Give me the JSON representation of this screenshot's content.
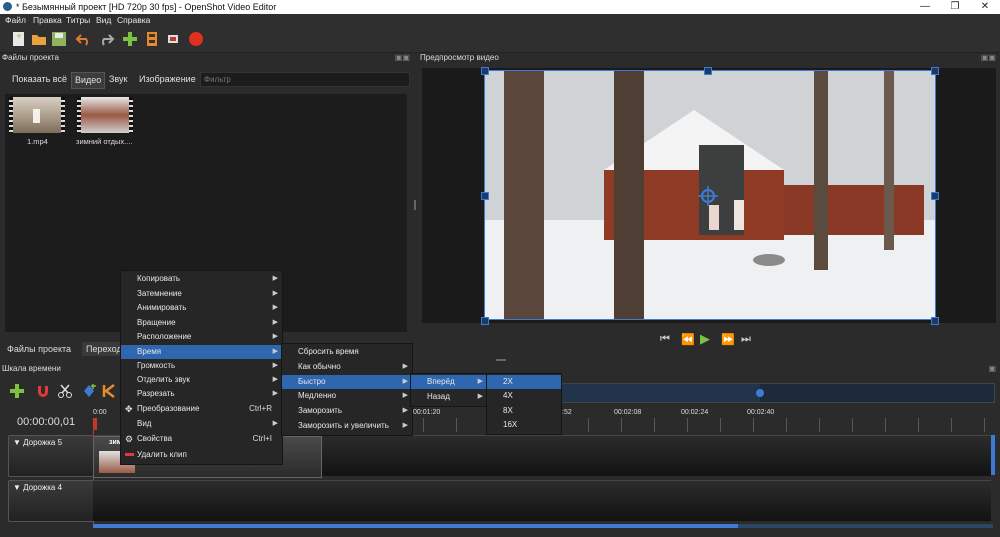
{
  "window": {
    "title": "* Безымянный проект [HD 720p 30 fps] - OpenShot Video Editor"
  },
  "menu": [
    "Файл",
    "Правка",
    "Титры",
    "Вид",
    "Справка"
  ],
  "toolbar": {
    "buttons": [
      "new-project-icon",
      "open-project-icon",
      "save-project-icon",
      "undo-icon",
      "redo-icon",
      "import-files-icon",
      "profile-icon",
      "fullscreen-icon",
      "export-video-icon"
    ]
  },
  "project_files": {
    "header": "Файлы проекта",
    "filters": [
      "Показать всё",
      "Видео",
      "Звук",
      "Изображение"
    ],
    "filter_placeholder": "Фильтр",
    "files": [
      "1.mp4",
      "зимний отдых...."
    ]
  },
  "preview": {
    "header": "Предпросмотр видео"
  },
  "bottom_tabs": [
    "Файлы проекта",
    "Переход"
  ],
  "timeline": {
    "header": "Шкала времени",
    "timecode": "00:00:00,01",
    "ruler_labels": [
      "0:00",
      "00:01:20",
      ":52",
      "00:02:08",
      "00:02:24",
      "00:02:40"
    ],
    "tracks": [
      "Дорожка 5",
      "Дорожка 4"
    ],
    "clip_label": "зим"
  },
  "context_menu": {
    "items": [
      {
        "label": "Копировать",
        "submenu": true
      },
      {
        "label": "Затемнение",
        "submenu": true
      },
      {
        "label": "Анимировать",
        "submenu": true
      },
      {
        "label": "Вращение",
        "submenu": true
      },
      {
        "label": "Расположение",
        "submenu": true
      },
      {
        "label": "Время",
        "submenu": true,
        "selected": true
      },
      {
        "label": "Громкость",
        "submenu": true
      },
      {
        "label": "Отделить звук",
        "submenu": true
      },
      {
        "label": "Разрезать",
        "submenu": true
      },
      {
        "label": "Преобразование",
        "shortcut": "Ctrl+R"
      },
      {
        "label": "Вид",
        "submenu": true
      },
      {
        "label": "Свойства",
        "shortcut": "Ctrl+I"
      },
      {
        "label": "Удалить клип"
      }
    ]
  },
  "time_submenu": {
    "items": [
      "Сбросить время",
      "Как обычно",
      "Быстро",
      "Медленно",
      "Заморозить",
      "Заморозить и увеличить"
    ],
    "selected": "Быстро"
  },
  "fast_submenu": {
    "items": [
      "Вперёд",
      "Назад"
    ],
    "selected": "Вперёд"
  },
  "forward_submenu": {
    "items": [
      "2X",
      "4X",
      "8X",
      "16X"
    ],
    "selected": "2X"
  },
  "colors": {
    "accent": "#2f66b0",
    "playhead": "#c0392b",
    "play_green": "#7cc342"
  }
}
